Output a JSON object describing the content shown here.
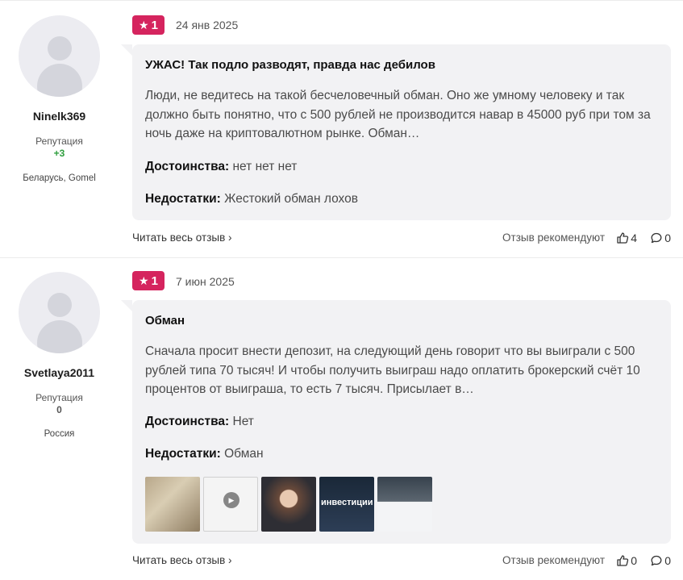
{
  "colors": {
    "rating_badge": "#d5245e",
    "positive_reputation": "#2e9e3e",
    "bubble_bg": "#f2f2f4"
  },
  "reviews": [
    {
      "user": {
        "name": "Ninelk369",
        "reputation_label": "Репутация",
        "reputation_value": "+3",
        "location": "Беларусь, Gomel"
      },
      "rating": "1",
      "date": "24 янв 2025",
      "title": "УЖАС! Так подло разводят, правда нас дебилов",
      "text": "Люди, не ведитесь на такой бесчеловечный обман. Оно же умному человеку и так должно быть понятно, что с 500 рублей не производится навар в 45000 руб при том за ночь даже на криптовалютном рынке. Обман…",
      "pros_label": "Достоинства:",
      "pros": "нет нет нет",
      "cons_label": "Недостатки:",
      "cons": "Жестокий обман лохов",
      "read_more": "Читать весь отзыв",
      "recommends": "Отзыв рекомендуют",
      "likes": "4",
      "comments": "0"
    },
    {
      "user": {
        "name": "Svetlaya2011",
        "reputation_label": "Репутация",
        "reputation_value": "0",
        "location": "Россия"
      },
      "rating": "1",
      "date": "7 июн 2025",
      "title": "Обман",
      "text": "Сначала просит внести депозит, на следующий день говорит что вы выиграли с 500 рублей типа 70 тысяч! И чтобы получить выиграш надо оплатить брокерский счёт 10 процентов от выиграша, то есть 7 тысяч. Присылает в…",
      "pros_label": "Достоинства:",
      "pros": "Нет",
      "cons_label": "Недостатки:",
      "cons": "Обман",
      "photo_caption": "инвестиции",
      "read_more": "Читать весь отзыв",
      "recommends": "Отзыв рекомендуют",
      "likes": "0",
      "comments": "0"
    }
  ],
  "icons": {
    "star": "star-icon",
    "chevron": "chevron-right-icon",
    "like": "thumbs-up-icon",
    "comment": "comment-icon",
    "play": "play-icon"
  }
}
